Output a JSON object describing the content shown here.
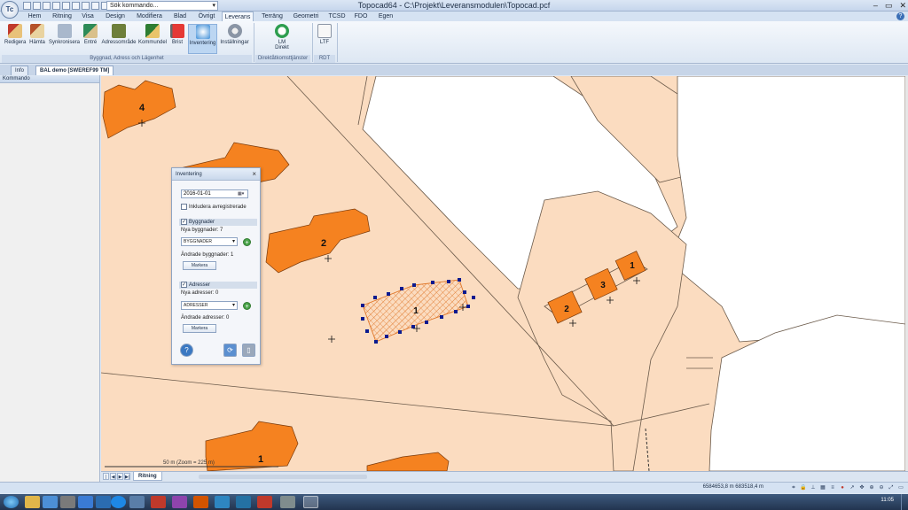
{
  "app": {
    "window_title": "Topocad64 - C:\\Projekt\\Leveransmodulen\\Topocad.pcf",
    "logo_text": "Tc",
    "search_placeholder": "Sök kommando..."
  },
  "menu": {
    "tabs": [
      "Hem",
      "Ritning",
      "Visa",
      "Design",
      "Modifiera",
      "Blad",
      "Övrigt",
      "Leverans",
      "Terräng",
      "Geometri",
      "TCSD",
      "FDO",
      "Egen"
    ],
    "active": "Leverans"
  },
  "ribbon": {
    "buttons": [
      "Redigera",
      "Hämta",
      "Synkronisera",
      "Entré",
      "Adressområde",
      "Kommundel",
      "Brist",
      "Inventering",
      "Inställningar"
    ],
    "active_button": "Inventering",
    "group1_label": "Byggnad, Adress och Lägenhet",
    "lm_button_line1": "LM",
    "lm_button_line2": "Direkt",
    "group2_label": "Direktåtkomsttjänster",
    "ltf_button": "LTF",
    "group3_label": "RDT"
  },
  "doc_tabs": {
    "info": "Info",
    "active": "BAL demo [SWEREF99 TM]"
  },
  "left_panel": {
    "title": "Kommando"
  },
  "map": {
    "labels": [
      "4",
      "2",
      "1",
      "2",
      "3",
      "1",
      "1"
    ],
    "scale_text": "50 m (Zoom = 225 m)"
  },
  "dialog": {
    "title": "Inventering",
    "date": "2016-01-01",
    "include_label": "Inkludera avregistrerade",
    "buildings_section": "Byggnader",
    "new_buildings_label": "Nya byggnader:",
    "new_buildings_count": "7",
    "buildings_select": "BYGGNADER",
    "changed_buildings_label": "Ändrade byggnader:",
    "changed_buildings_count": "1",
    "mark_button_1": "Markera",
    "addresses_section": "Adresser",
    "new_addresses_label": "Nya adresser:",
    "new_addresses_count": "0",
    "addresses_select": "ADRESSER",
    "changed_addresses_label": "Ändrade adresser:",
    "changed_addresses_count": "0",
    "mark_button_2": "Markera"
  },
  "bottom": {
    "drawing_tab": "Ritning"
  },
  "status": {
    "coordinates": "6584653,8 m 683518,4 m",
    "clock": "11:05"
  },
  "colors": {
    "map_land": "#fbdcc0",
    "building": "#f58220",
    "selected_building": "#f3a35a",
    "selection_handle": "#0a1a8f",
    "ribbon_accent": "#bcd6f2"
  }
}
